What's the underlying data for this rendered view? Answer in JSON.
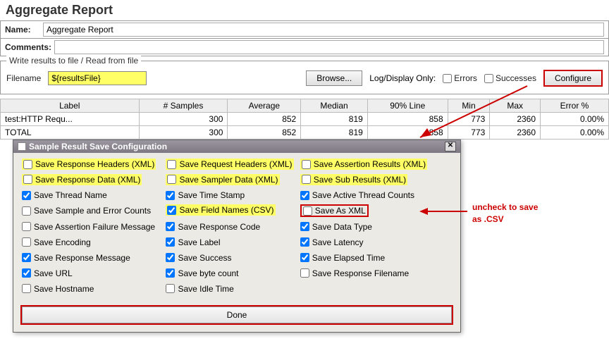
{
  "title": "Aggregate Report",
  "name_label": "Name:",
  "name_value": "Aggregate Report",
  "comments_label": "Comments:",
  "fieldset_legend": "Write results to file / Read from file",
  "filename_label": "Filename",
  "filename_value": "${resultsFile}",
  "browse_label": "Browse...",
  "logdisplay_label": "Log/Display Only:",
  "errors_label": "Errors",
  "successes_label": "Successes",
  "configure_label": "Configure",
  "table": {
    "headers": [
      "Label",
      "# Samples",
      "Average",
      "Median",
      "90% Line",
      "Min",
      "Max",
      "Error %"
    ],
    "rows": [
      {
        "label": "test:HTTP Requ...",
        "samples": "300",
        "avg": "852",
        "median": "819",
        "p90": "858",
        "min": "773",
        "max": "2360",
        "err": "0.00%"
      },
      {
        "label": "TOTAL",
        "samples": "300",
        "avg": "852",
        "median": "819",
        "p90": "858",
        "min": "773",
        "max": "2360",
        "err": "0.00%"
      }
    ]
  },
  "dialog_title": "Sample Result Save Configuration",
  "opts": {
    "r0c0": "Save Response Headers (XML)",
    "r0c1": "Save Request Headers (XML)",
    "r0c2": "Save Assertion Results (XML)",
    "r1c0": "Save Response Data (XML)",
    "r1c1": "Save Sampler Data (XML)",
    "r1c2": "Save Sub Results (XML)",
    "r2c0": "Save Thread Name",
    "r2c1": "Save Time Stamp",
    "r2c2": "Save Active Thread Counts",
    "r3c0": "Save Sample and Error Counts",
    "r3c1": "Save Field Names (CSV)",
    "r3c2": "Save As XML",
    "r4c0": "Save Assertion Failure Message",
    "r4c1": "Save Response Code",
    "r4c2": "Save Data Type",
    "r5c0": "Save Encoding",
    "r5c1": "Save Label",
    "r5c2": "Save Latency",
    "r6c0": "Save Response Message",
    "r6c1": "Save Success",
    "r6c2": "Save Elapsed Time",
    "r7c0": "Save URL",
    "r7c1": "Save byte count",
    "r7c2": "Save Response Filename",
    "r8c0": "Save Hostname",
    "r8c1": "Save Idle Time"
  },
  "done_label": "Done",
  "note_line1": "uncheck to save",
  "note_line2": "as .CSV"
}
